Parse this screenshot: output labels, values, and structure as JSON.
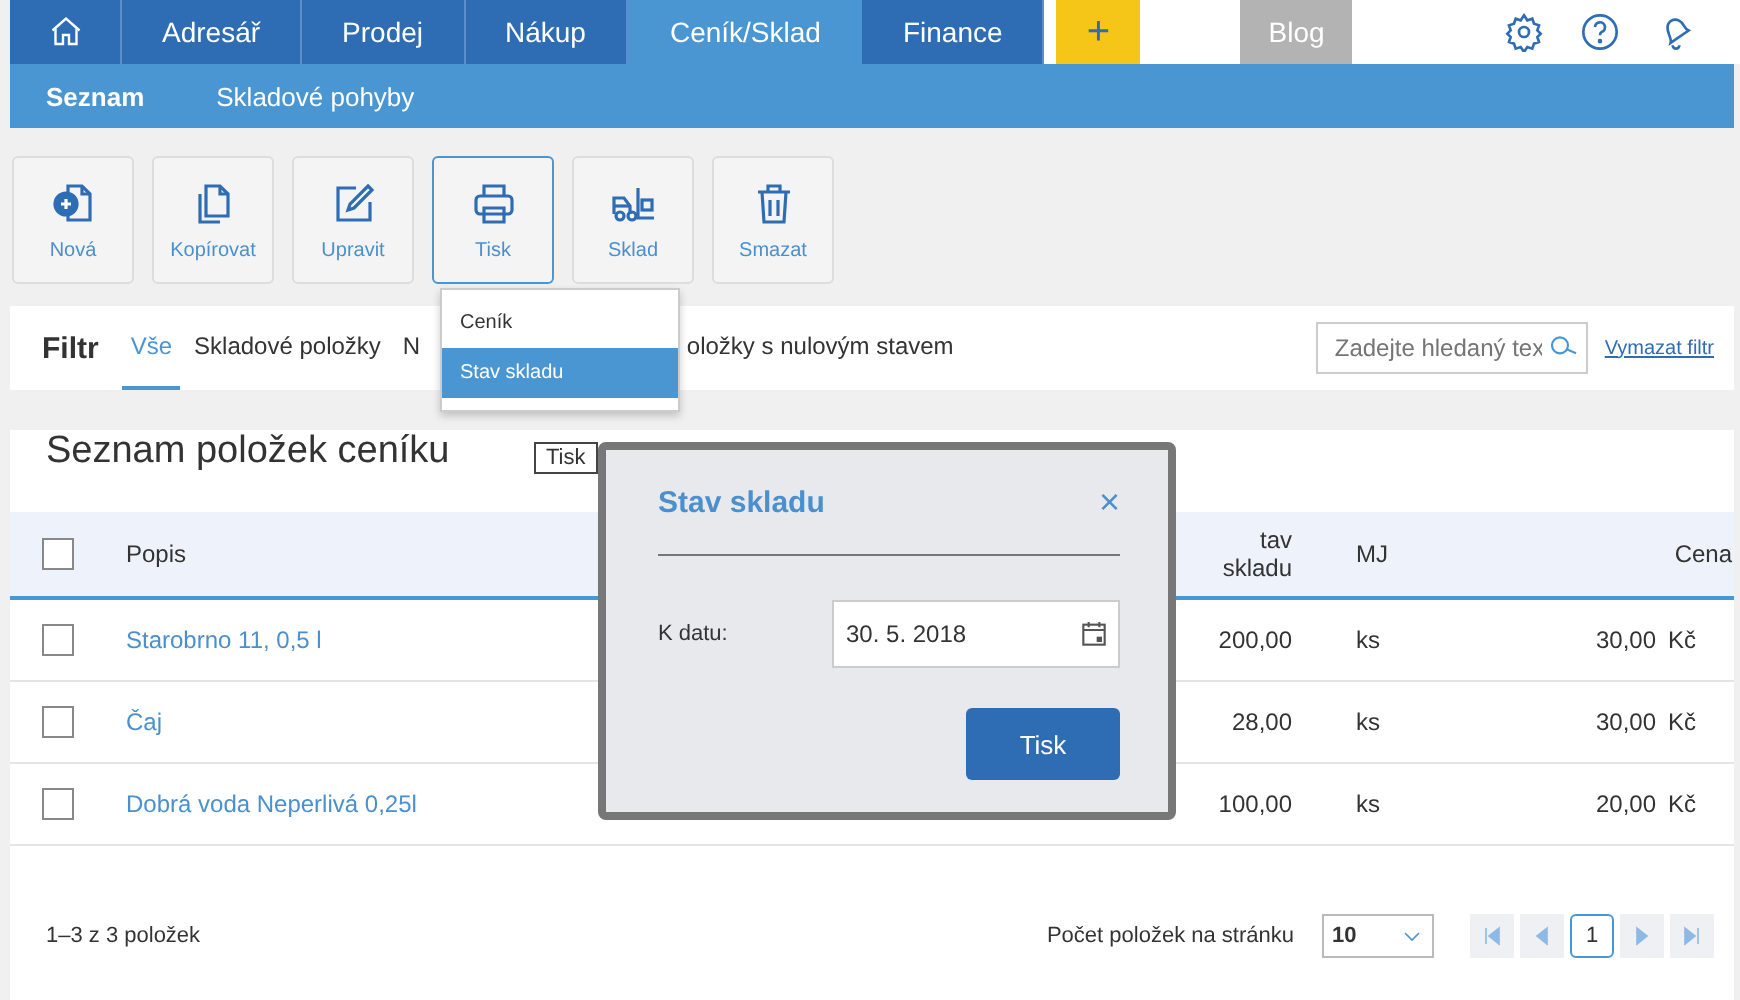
{
  "nav": {
    "tabs": [
      {
        "label": "Adresář",
        "selected": false
      },
      {
        "label": "Prodej",
        "selected": false
      },
      {
        "label": "Nákup",
        "selected": false
      },
      {
        "label": "Ceník/Sklad",
        "selected": true
      },
      {
        "label": "Finance",
        "selected": false
      }
    ],
    "add_label": "+",
    "blog_label": "Blog"
  },
  "subnav": [
    {
      "label": "Seznam",
      "selected": true
    },
    {
      "label": "Skladové pohyby",
      "selected": false
    }
  ],
  "toolbar": [
    {
      "kind": "new",
      "label": "Nová",
      "selected": false
    },
    {
      "kind": "copy",
      "label": "Kopírovat",
      "selected": false
    },
    {
      "kind": "edit",
      "label": "Upravit",
      "selected": false
    },
    {
      "kind": "print",
      "label": "Tisk",
      "selected": true
    },
    {
      "kind": "stock",
      "label": "Sklad",
      "selected": false
    },
    {
      "kind": "delete",
      "label": "Smazat",
      "selected": false
    }
  ],
  "filter": {
    "title": "Filtr",
    "tabs": [
      {
        "label": "Vše",
        "selected": true
      },
      {
        "label": "Skladové položky",
        "selected": false
      },
      {
        "label": "N",
        "selected": false
      },
      {
        "label": "oložky s nulovým stavem",
        "selected": false
      }
    ],
    "search_placeholder": "Zadejte hledaný tex",
    "clear_link": "Vymazat filtr"
  },
  "print_menu": [
    {
      "label": "Ceník",
      "selected": false
    },
    {
      "label": "Stav skladu",
      "selected": true
    }
  ],
  "tooltip": "Tisk",
  "list": {
    "title": "Seznam položek ceníku",
    "all_checked": false,
    "columns": [
      "Popis",
      "tav skladu",
      "MJ",
      "Cena"
    ],
    "rows": [
      {
        "name": "Starobrno 11, 0,5 l",
        "stock": "200,00",
        "unit": "ks",
        "price": "30,00",
        "currency": "Kč",
        "checked": false
      },
      {
        "name": "Čaj",
        "stock": "28,00",
        "unit": "ks",
        "price": "30,00",
        "currency": "Kč",
        "checked": false
      },
      {
        "name": "Dobrá voda Neperlivá 0,25l",
        "stock": "100,00",
        "unit": "ks",
        "price": "20,00",
        "currency": "Kč",
        "checked": false
      }
    ]
  },
  "pager": {
    "summary": "1–3 z 3 položek",
    "per_page_label": "Počet položek na stránku",
    "per_page": "10",
    "page": "1"
  },
  "dialog": {
    "title": "Stav skladu",
    "close": "×",
    "date_label": "K datu:",
    "date_value": "30. 5. 2018",
    "button": "Tisk"
  }
}
